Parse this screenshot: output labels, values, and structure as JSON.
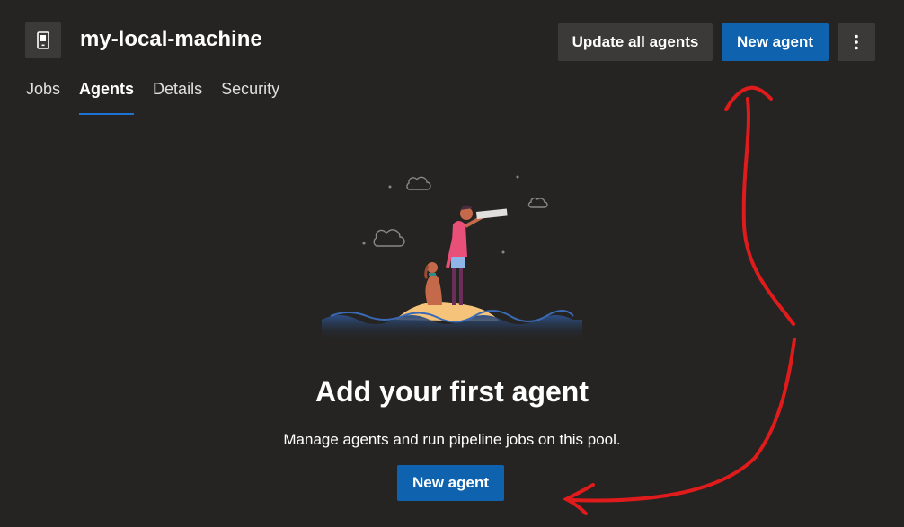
{
  "header": {
    "title": "my-local-machine",
    "icon": "server-icon"
  },
  "toolbar": {
    "update_all_label": "Update all agents",
    "new_agent_label": "New agent",
    "more_icon": "more-vertical-icon"
  },
  "tabs": [
    {
      "label": "Jobs",
      "active": false
    },
    {
      "label": "Agents",
      "active": true
    },
    {
      "label": "Details",
      "active": false
    },
    {
      "label": "Security",
      "active": false
    }
  ],
  "empty_state": {
    "title": "Add your first agent",
    "description": "Manage agents and run pipeline jobs on this pool.",
    "button_label": "New agent"
  },
  "colors": {
    "background": "#252423",
    "primary": "#0f62ae",
    "secondary": "#3b3a39",
    "tab_underline": "#1b74d1",
    "annotation": "#e01b1b"
  }
}
